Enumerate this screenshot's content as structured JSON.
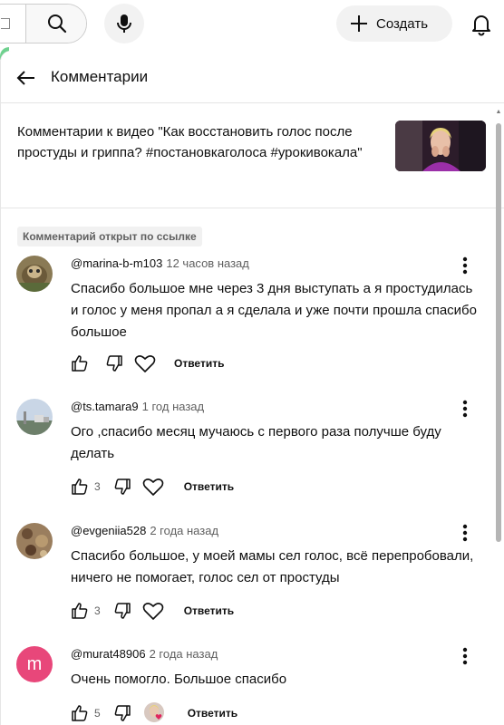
{
  "topbar": {
    "create_label": "Создать"
  },
  "panel": {
    "title": "Комментарии",
    "video_text": "Комментарии к видео \"Как восстановить голос после простуды и гриппа? #постановкаголоса #урокивокала\""
  },
  "linked_badge": "Комментарий открыт по ссылке",
  "comments": [
    {
      "author": "@marina-b-m103",
      "time": "12 часов назад",
      "text": "Спасибо большое мне через 3 дня выступать а я простудилась и голос у меня пропал а я сделала и уже почти прошла спасибо большое",
      "likes": "",
      "reply": "Ответить"
    },
    {
      "author": "@ts.tamara9",
      "time": "1 год назад",
      "text": "Ого ,спасибо месяц мучаюсь с первого раза получше  буду делать",
      "likes": "3",
      "reply": "Ответить"
    },
    {
      "author": "@evgeniia528",
      "time": "2 года назад",
      "text": "Спасибо большое, у моей мамы сел голос, всё перепробовали, ничего не помогает, голос сел от простуды",
      "likes": "3",
      "reply": "Ответить"
    },
    {
      "author": "@murat48906",
      "time": "2 года назад",
      "text": "Очень помогло. Большое спасибо",
      "likes": "5",
      "reply": "Ответить",
      "avatar_letter": "m",
      "avatar_color": "#e8477a"
    }
  ]
}
